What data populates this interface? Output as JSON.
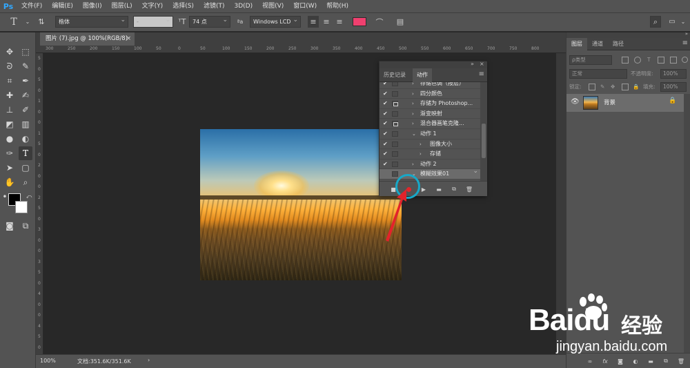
{
  "app": {
    "logo": "Ps",
    "menu": [
      "文件(F)",
      "编辑(E)",
      "图像(I)",
      "图层(L)",
      "文字(Y)",
      "选择(S)",
      "滤镜(T)",
      "3D(D)",
      "视图(V)",
      "窗口(W)",
      "帮助(H)"
    ]
  },
  "options": {
    "tool_glyph": "T",
    "font_family": "楷体",
    "font_style": "-",
    "font_size": "74 点",
    "aa_label": "ªa",
    "aa_mode": "Windows LCD",
    "text_color": "#f0406f"
  },
  "document": {
    "tab_title": "图片 (7).jpg @ 100%(RGB/8)",
    "close": "×",
    "zoom": "100%",
    "doc_info": "文档:351.6K/351.6K",
    "status_arrow": "›"
  },
  "rulers": {
    "top": [
      "300",
      "250",
      "200",
      "150",
      "100",
      "50",
      "0",
      "50",
      "100",
      "150",
      "200",
      "250",
      "300",
      "350",
      "400",
      "450",
      "500",
      "550",
      "600",
      "650",
      "700",
      "750",
      "800"
    ],
    "left": [
      "5",
      "0",
      "5",
      "0",
      "1",
      "0",
      "0",
      "1",
      "5",
      "0",
      "2",
      "0",
      "0",
      "2",
      "5",
      "0",
      "3",
      "0",
      "0",
      "3",
      "5",
      "0",
      "4",
      "0",
      "0",
      "4",
      "5",
      "0"
    ]
  },
  "actions_panel": {
    "tabs": [
      "历史记录",
      "动作"
    ],
    "active_tab": "动作",
    "collapse": "»",
    "close": "×",
    "rows": [
      {
        "check": "✔",
        "dialog": false,
        "indent": 0,
        "expanded": false,
        "label": "存储色调（按层）"
      },
      {
        "check": "✔",
        "dialog": false,
        "indent": 0,
        "expanded": false,
        "label": "四分颜色"
      },
      {
        "check": "✔",
        "dialog": true,
        "indent": 0,
        "expanded": false,
        "label": "存储为 Photoshop..."
      },
      {
        "check": "✔",
        "dialog": false,
        "indent": 0,
        "expanded": false,
        "label": "渐变映射"
      },
      {
        "check": "✔",
        "dialog": true,
        "indent": 0,
        "expanded": false,
        "label": "混合器画笔克隆..."
      },
      {
        "check": "✔",
        "dialog": false,
        "indent": 0,
        "expanded": true,
        "label": "动作 1"
      },
      {
        "check": "✔",
        "dialog": false,
        "indent": 1,
        "expanded": false,
        "label": "图像大小"
      },
      {
        "check": "✔",
        "dialog": false,
        "indent": 1,
        "expanded": false,
        "label": "存储"
      },
      {
        "check": "✔",
        "dialog": false,
        "indent": 0,
        "expanded": false,
        "label": "动作 2"
      },
      {
        "check": "",
        "dialog": false,
        "indent": 0,
        "expanded": true,
        "label": "模糊效果01",
        "selected": true
      }
    ],
    "buttons": [
      "stop",
      "record",
      "play",
      "new-set",
      "new-action",
      "delete"
    ]
  },
  "layers_panel": {
    "tabs": [
      "图层",
      "通道",
      "路径"
    ],
    "active_tab": "图层",
    "filter_label": "ρ类型",
    "blend_mode": "正常",
    "opacity_label": "不透明度:",
    "opacity_value": "100%",
    "lock_label": "锁定:",
    "fill_label": "填充:",
    "fill_value": "100%",
    "layer_name": "背景",
    "bottom_icons": [
      "link",
      "fx",
      "mask",
      "adjustment",
      "group",
      "new-layer",
      "delete"
    ]
  },
  "watermark": {
    "logo_text": "Bai",
    "logo_text_2": "du",
    "cn": "经验",
    "url": "jingyan.baidu.com"
  },
  "colors": {
    "accent": "#31a8ff",
    "record": "#e0262b",
    "annotation": "#17a8c8",
    "arrow": "#e2232b",
    "text_swatch": "#f0406f"
  }
}
